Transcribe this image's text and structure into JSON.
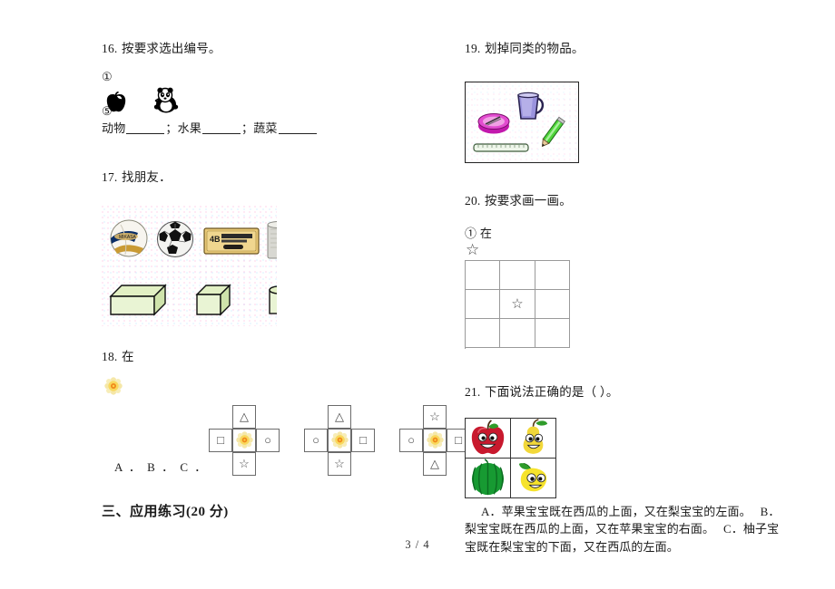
{
  "document": {
    "page_label": "3 / 4",
    "section_heading": "三、应用练习(20 分)"
  },
  "questions": {
    "q16": {
      "number": "16.",
      "text": "按要求选出编号。",
      "mark_first": "①",
      "mark_second": "⑤",
      "image_items": [
        "apple",
        "panda"
      ],
      "blanks_label_1": "动物",
      "blanks_sep_1": "；",
      "blanks_label_2": "水果",
      "blanks_sep_2": "；",
      "blanks_label_3": "蔬菜"
    },
    "q17": {
      "number": "17.",
      "text": "找朋友．",
      "image_items": [
        "volleyball",
        "soccer-ball",
        "eraser-4b",
        "canister",
        "cuboid",
        "cube",
        "cylinder-partial"
      ]
    },
    "q18": {
      "number": "18.",
      "text": "在",
      "cue_icon": "flower",
      "options_label": "A ． B ． C ．",
      "crosses": [
        {
          "top": "△",
          "left": "□",
          "center": "flower",
          "right": "○",
          "bottom": "☆"
        },
        {
          "top": "△",
          "left": "○",
          "center": "flower",
          "right": "□",
          "bottom": "☆"
        },
        {
          "top": "☆",
          "left": "○",
          "center": "flower",
          "right": "□",
          "bottom": "△"
        }
      ]
    },
    "q19": {
      "number": "19.",
      "text": "划掉同类的物品。",
      "image_items": [
        "palette",
        "mug",
        "pencil",
        "ruler"
      ]
    },
    "q20": {
      "number": "20.",
      "text": "按要求画一画。",
      "sub_mark": "①",
      "sub_text": "在",
      "cue_icon": "☆",
      "grid": {
        "rows": 3,
        "cols": 3,
        "cells": [
          "",
          "",
          "",
          "",
          "☆",
          "",
          "",
          "",
          ""
        ]
      }
    },
    "q21": {
      "number": "21.",
      "text": "下面说法正确的是（  ）。",
      "fruits": [
        {
          "name": "apple",
          "color": "#c8192e"
        },
        {
          "name": "pear",
          "color": "#f2d83a"
        },
        {
          "name": "watermelon",
          "color": "#179a32"
        },
        {
          "name": "pomelo",
          "color": "#f6e32c"
        }
      ],
      "options_text": "A．苹果宝宝既在西瓜的上面，又在梨宝宝的左面。　 B．梨宝宝既在西瓜的上面，又在苹果宝宝的右面。　 C．柚子宝宝既在梨宝宝的下面，又在西瓜的左面。"
    }
  }
}
